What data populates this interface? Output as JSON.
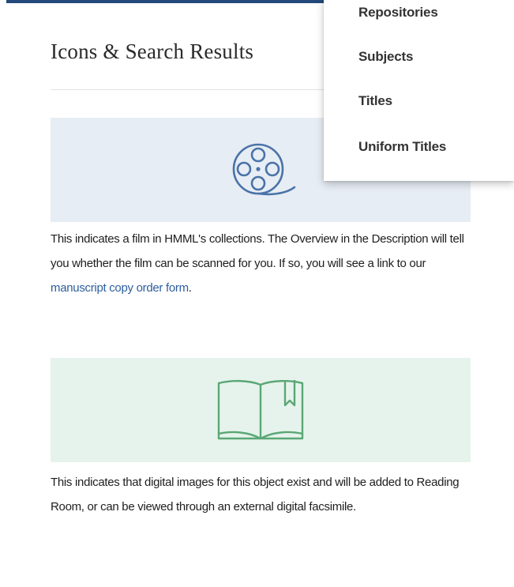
{
  "section": {
    "title": "Icons & Search Results"
  },
  "film_entry": {
    "icon": "film-reel-icon",
    "text_before_link": "This indicates a film in HMML's collections. The Overview in the Description will tell you whether the film can be scanned for you. If so, you will see a link to our ",
    "link_text": "manuscript copy order form",
    "text_after_link": "."
  },
  "digital_entry": {
    "icon": "open-book-icon",
    "text": "This indicates that digital images for this object exist and will be added to Reading Room, or can be viewed through an external digital facsimile."
  },
  "dropdown_menu": {
    "items": [
      {
        "label": "Repositories"
      },
      {
        "label": "Subjects"
      },
      {
        "label": "Titles"
      },
      {
        "label": "Uniform Titles"
      }
    ]
  },
  "colors": {
    "card_top_border": "#23497a",
    "film_panel_bg": "#e7edf4",
    "film_icon": "#4a73a8",
    "book_panel_bg": "#e6f3ec",
    "book_icon": "#5aa775",
    "link": "#2d5e9e"
  }
}
